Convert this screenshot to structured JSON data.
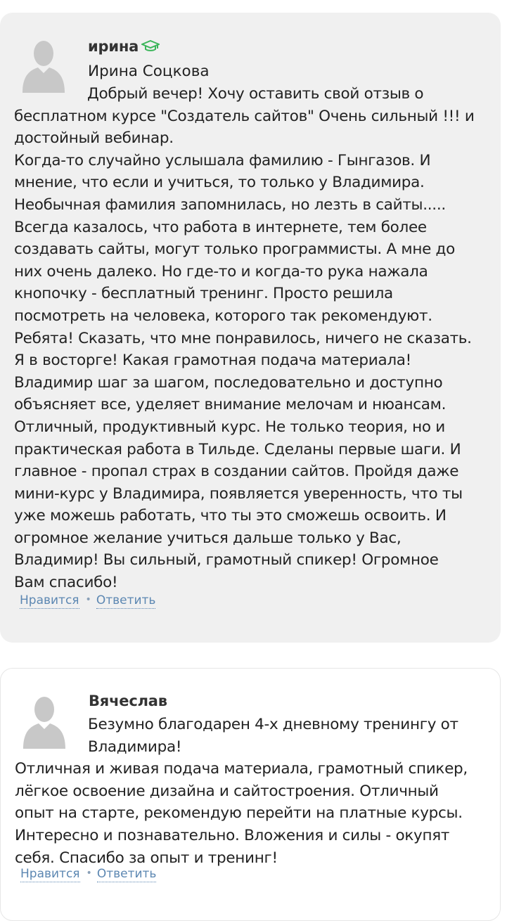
{
  "comments": [
    {
      "author": "ирина",
      "badge_icon": "graduation-cap-icon",
      "badge_color": "#3bb55a",
      "full_name": "Ирина Соцкова",
      "text_first": "Добрый вечер! Хочу оставить свой отзыв о",
      "text_rest": "бесплатном курсе \"Создатель сайтов\" Очень сильный !!! и\nдостойный вебинар.\nКогда-то случайно услышала фамилию - Гынгазов. И\nмнение, что если и учиться, то только у Владимира.\nНеобычная фамилия запомнилась, но лезть в сайты.....\nВсегда казалось, что работа в интернете, тем более\nсоздавать сайты, могут только программисты. А мне до\nних очень далеко. Но где-то и когда-то рука нажала\nкнопочку - бесплатный тренинг. Просто решила\nпосмотреть на человека, которого так рекомендуют.\nРебята! Сказать, что мне понравилось, ничего не сказать.\nЯ в восторге! Какая грамотная подача материала!\nВладимир шаг за шагом, последовательно и доступно\nобъясняет все, уделяет внимание мелочам и нюансам.\nОтличный, продуктивный курс. Не только теория, но и\nпрактическая работа в Тильде. Сделаны первые шаги. И\nглавное - пропал страх в создании сайтов. Пройдя даже\nмини-курс у Владимира, появляется уверенность, что ты\nуже можешь работать, что ты это сможешь освоить. И\nогромное желание учиться дальше только у Вас,\nВладимир! Вы сильный, грамотный спикер! Огромное\nВам спасибо!",
      "like_label": "Нравится",
      "reply_label": "Ответить"
    },
    {
      "author": "Вячеслав",
      "text_first": "Безумно благодарен 4-х дневному тренингу от",
      "text_second": "Владимира!",
      "text_rest": "Отличная и живая подача материала, грамотный спикер,\nлёгкое освоение дизайна и сайтостроения. Отличный\nопыт на старте, рекомендую перейти на платные курсы.\nИнтересно и познавательно. Вложения и силы - окупят\nсебя. Спасибо за опыт и тренинг!",
      "like_label": "Нравится",
      "reply_label": "Ответить"
    }
  ],
  "separator": "•",
  "colors": {
    "card_bg": "#f0f0f0",
    "link": "#5c87b2",
    "avatar": "#c8c8c8"
  }
}
